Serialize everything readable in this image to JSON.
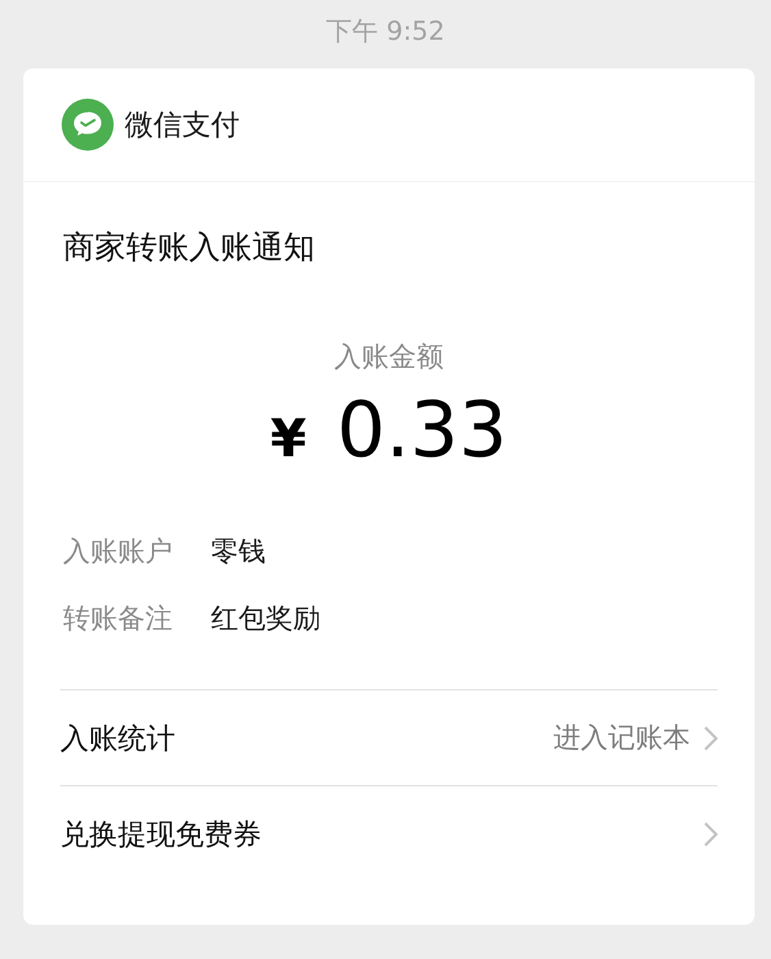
{
  "time": "下午 9:52",
  "card": {
    "app_name": "微信支付",
    "title": "商家转账入账通知",
    "amount_label": "入账金额",
    "currency": "¥",
    "amount": "0.33",
    "details": [
      {
        "label": "入账账户",
        "value": "零钱"
      },
      {
        "label": "转账备注",
        "value": "红包奖励"
      }
    ],
    "links": [
      {
        "label": "入账统计",
        "hint": "进入记账本"
      },
      {
        "label": "兑换提现免费券"
      }
    ]
  }
}
